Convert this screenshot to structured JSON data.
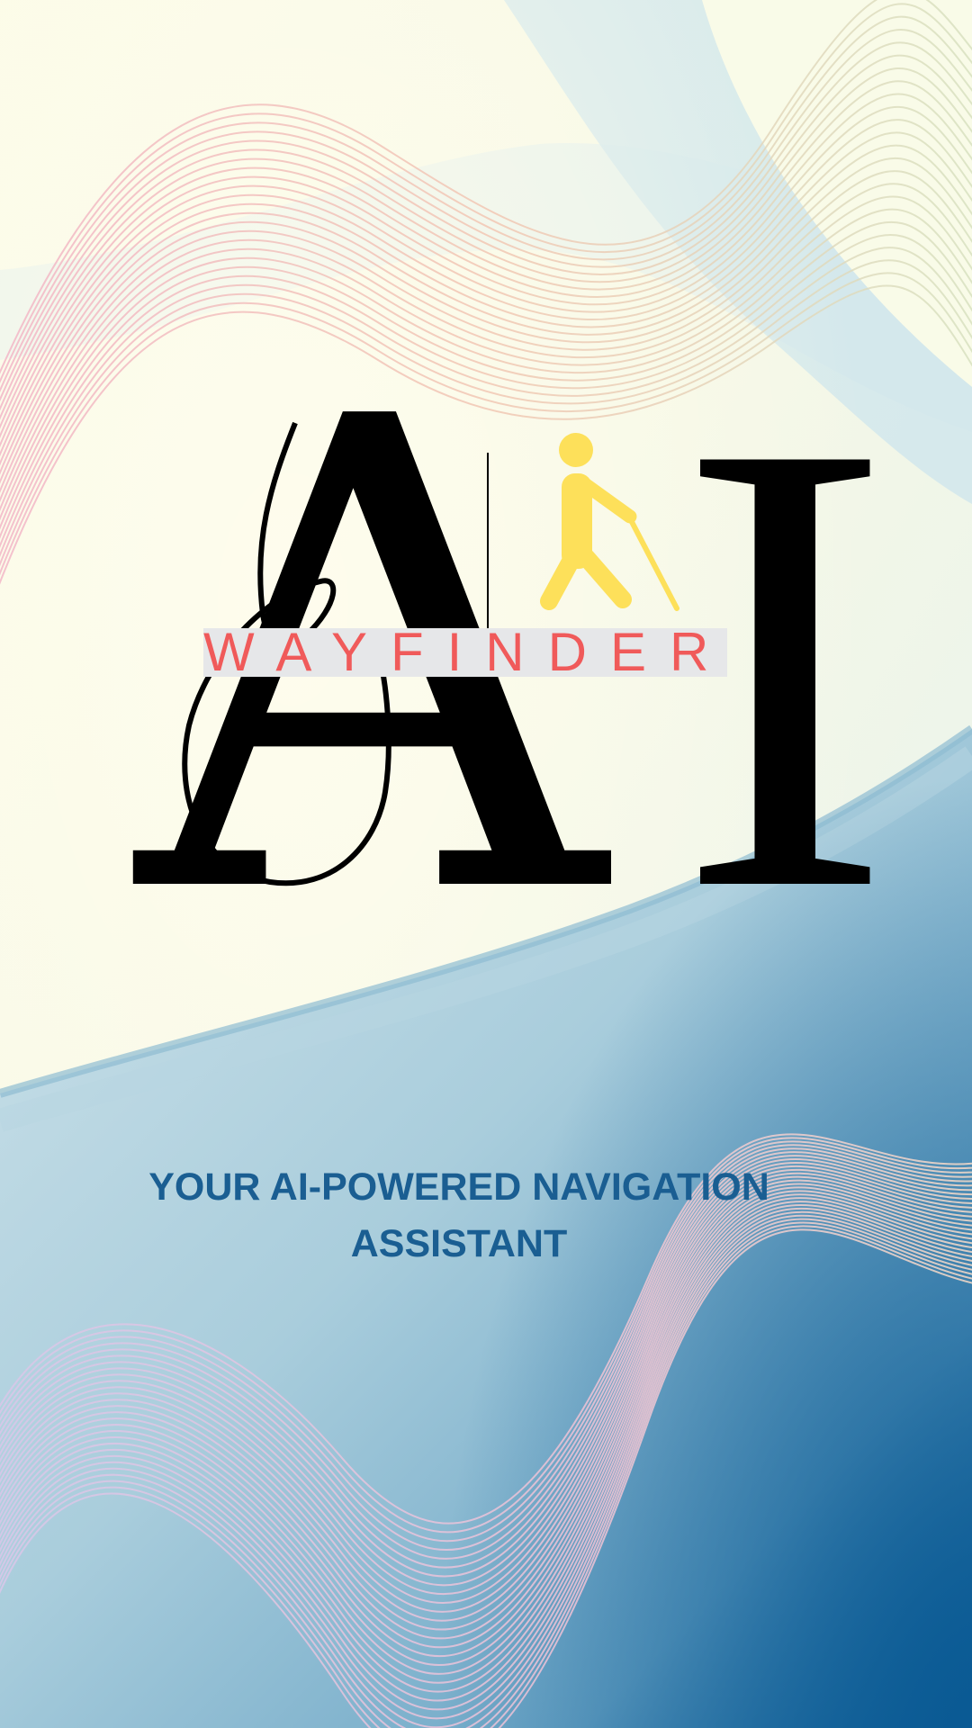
{
  "logo": {
    "monogram_first": "A",
    "monogram_second": "I",
    "brand_name": "WAYFINDER",
    "figure_icon": "blind-person-with-cane-icon"
  },
  "tagline": {
    "line1": "YOUR AI-POWERED NAVIGATION",
    "line2": "ASSISTANT"
  },
  "colors": {
    "brand_name": "#f05a5a",
    "figure": "#fde05a",
    "tagline": "#1a5e92",
    "monogram": "#000000"
  }
}
